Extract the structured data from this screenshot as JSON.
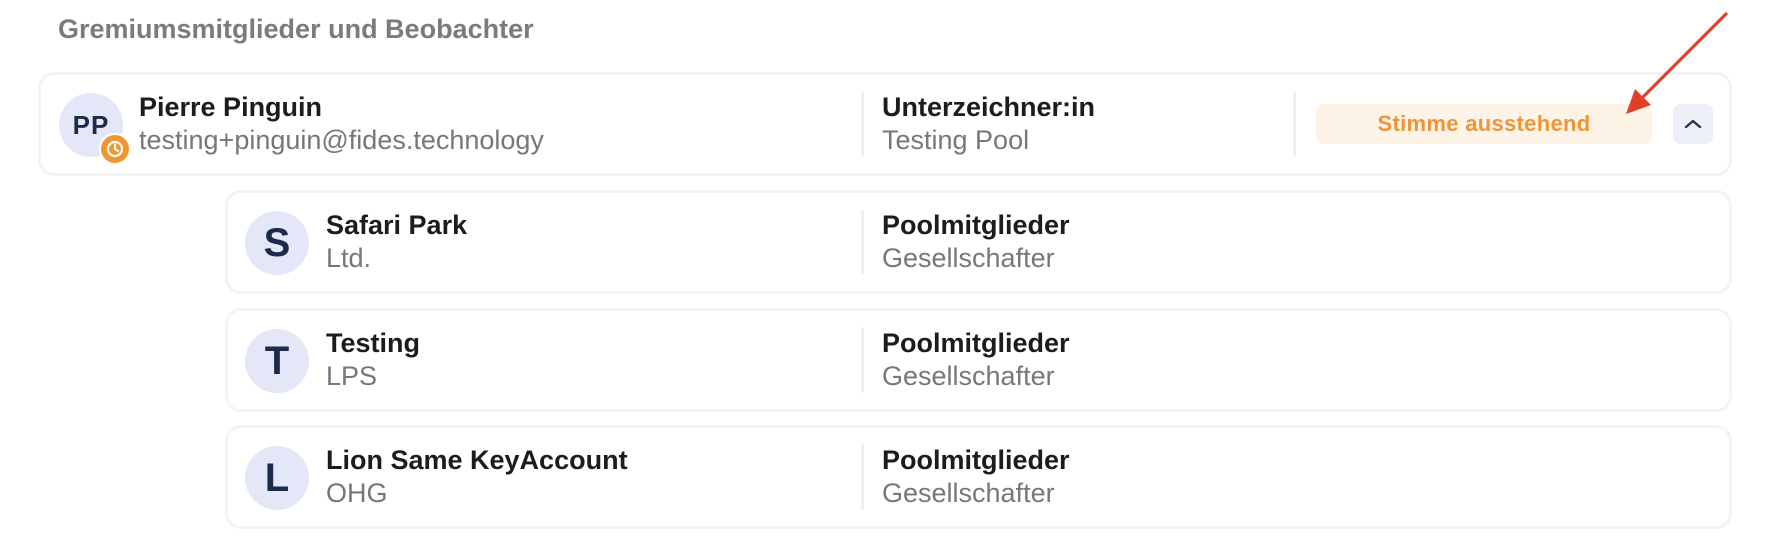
{
  "section": {
    "title": "Gremiumsmitglieder und Beobachter"
  },
  "main_member": {
    "initials": "PP",
    "name": "Pierre Pinguin",
    "email": "testing+pinguin@fides.technology",
    "role": "Unterzeichner:in",
    "pool": "Testing Pool",
    "status": "Stimme ausstehend",
    "status_icon": "clock-icon",
    "toggle_icon": "chevron-up-icon"
  },
  "pool_members": [
    {
      "initial": "S",
      "name": "Safari Park",
      "sub": "Ltd.",
      "role": "Poolmitglieder",
      "role_sub": "Gesellschafter"
    },
    {
      "initial": "T",
      "name": "Testing",
      "sub": "LPS",
      "role": "Poolmitglieder",
      "role_sub": "Gesellschafter"
    },
    {
      "initial": "L",
      "name": "Lion Same KeyAccount",
      "sub": "OHG",
      "role": "Poolmitglieder",
      "role_sub": "Gesellschafter"
    }
  ],
  "colors": {
    "accent_orange": "#ee9538",
    "badge_bg": "#fdf3e6",
    "avatar_bg": "#e3e7f7",
    "annotation_arrow": "#e0402a"
  }
}
